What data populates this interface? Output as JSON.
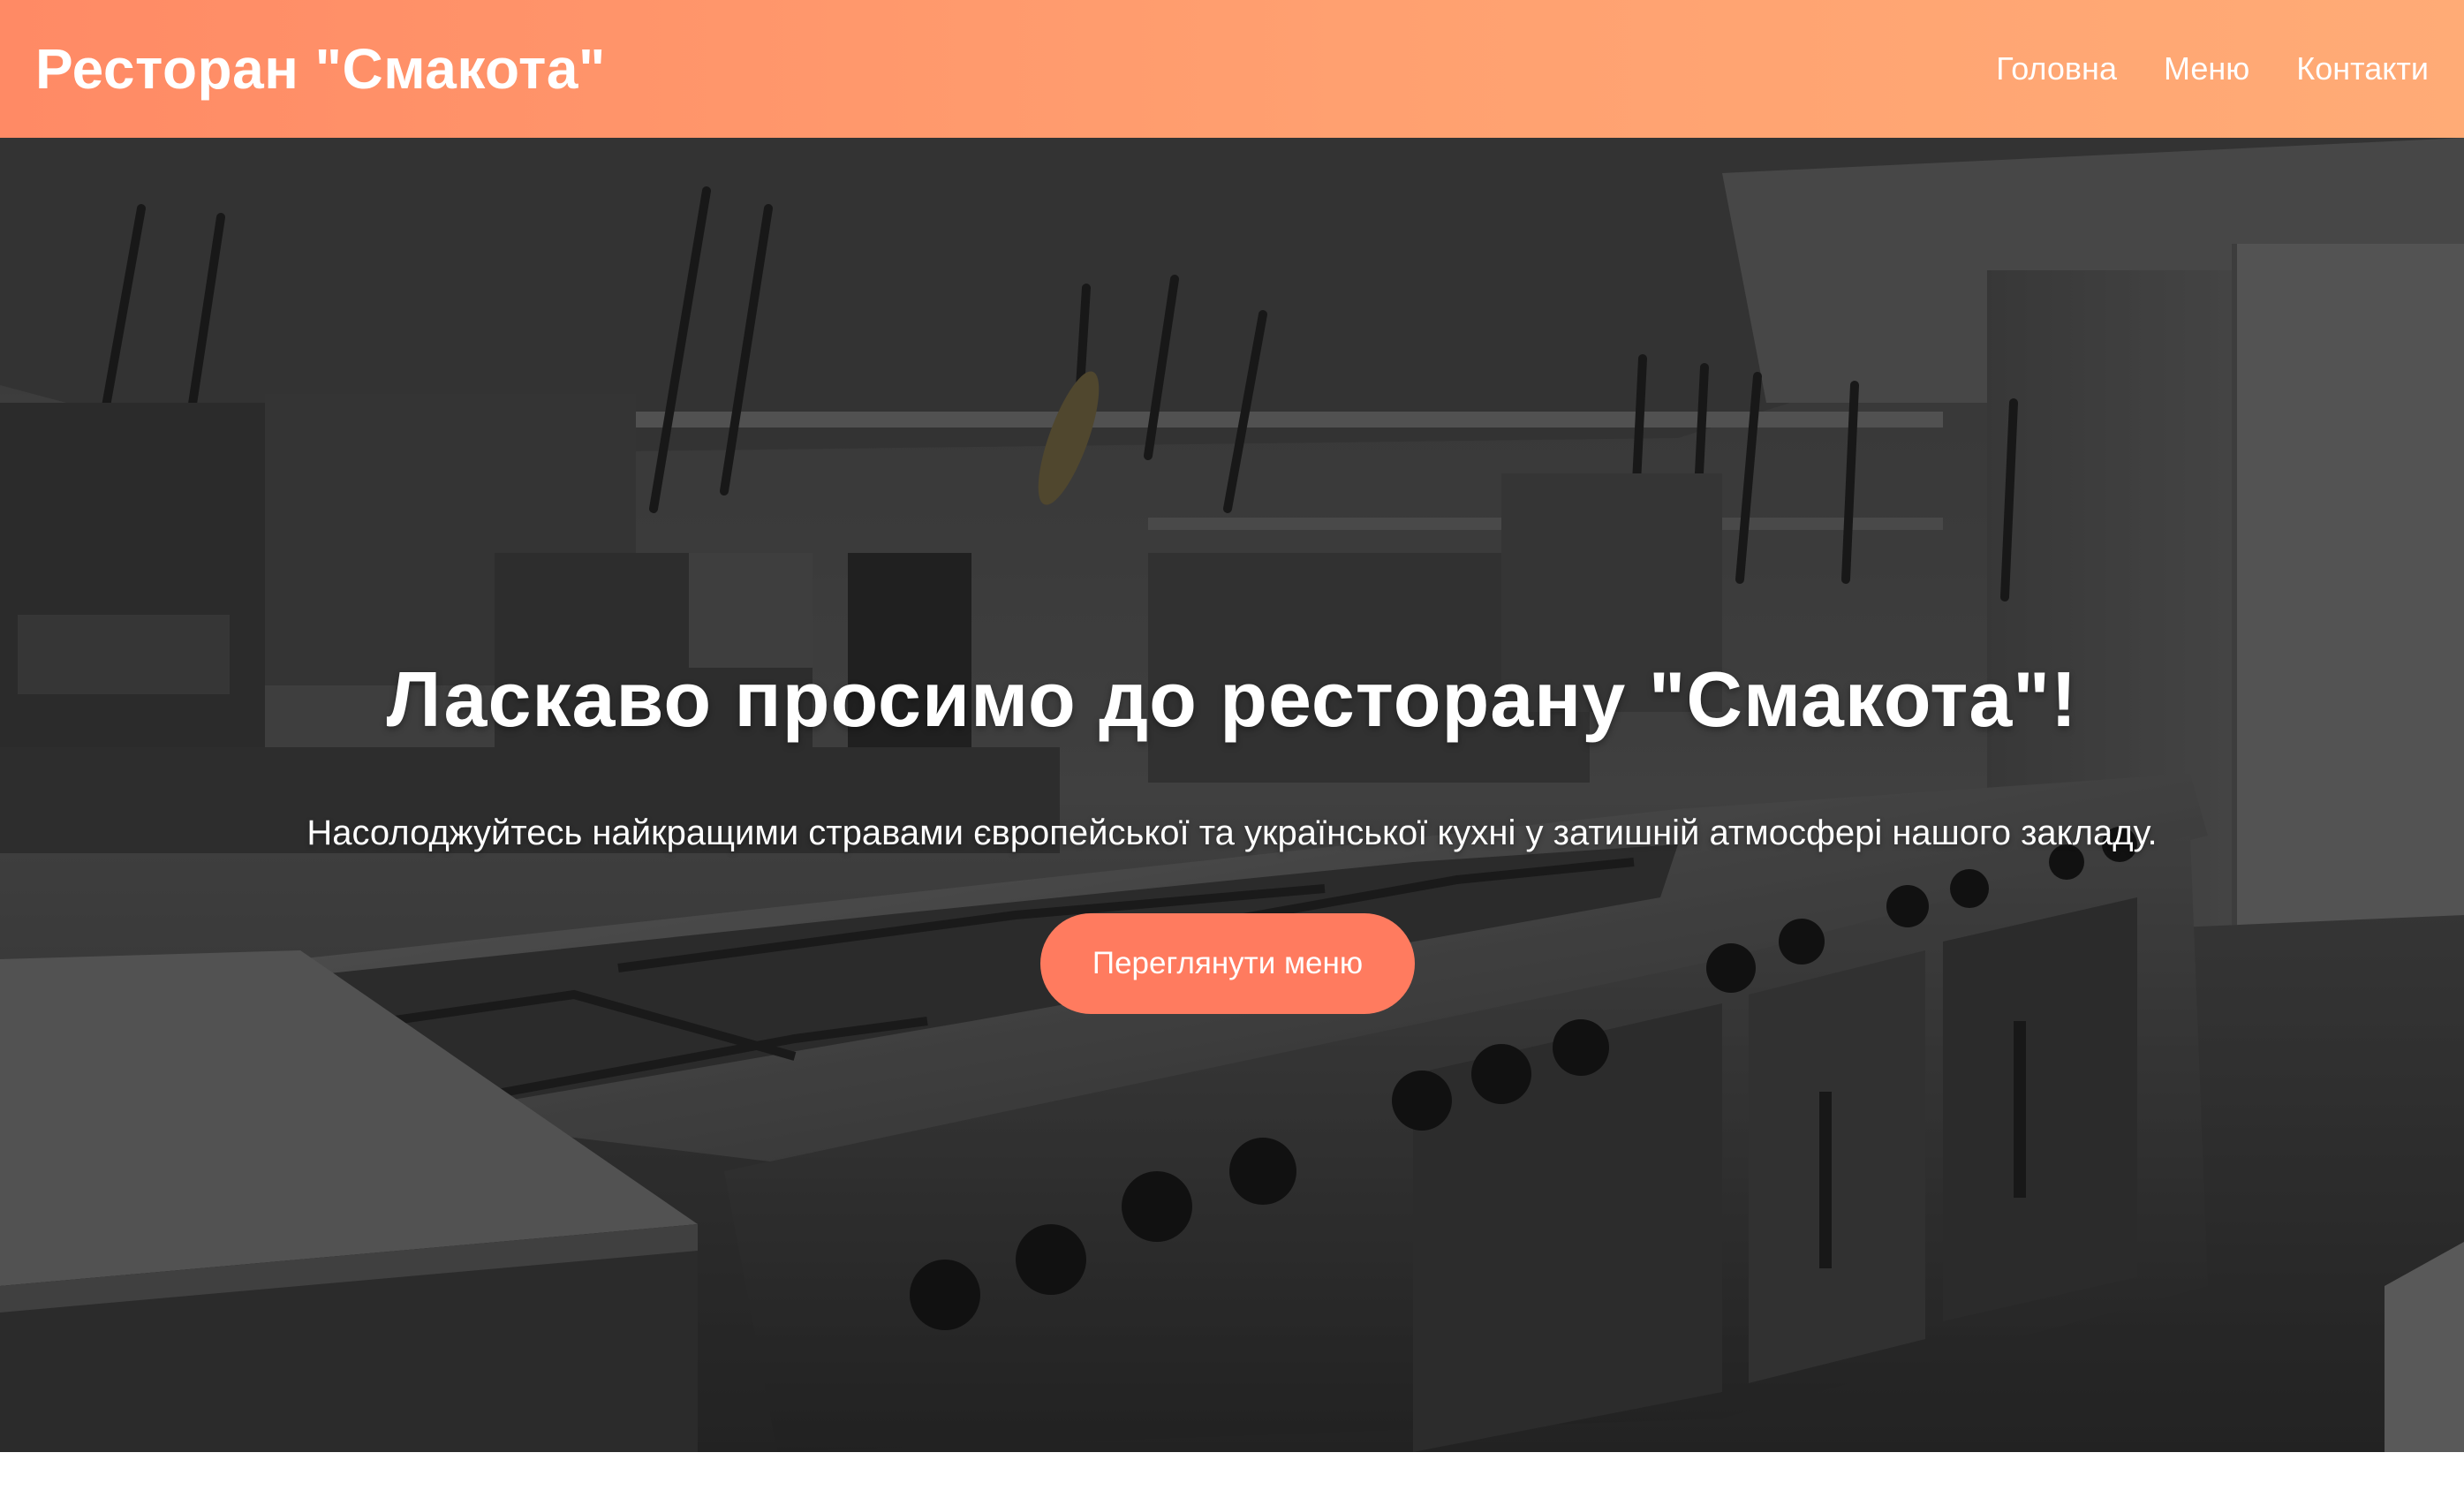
{
  "header": {
    "brand": "Ресторан \"Смакота\"",
    "nav": [
      {
        "label": "Головна"
      },
      {
        "label": "Меню"
      },
      {
        "label": "Контакти"
      }
    ]
  },
  "hero": {
    "title": "Ласкаво просимо до ресторану \"Смакота\"!",
    "subtitle": "Насолоджуйтесь найкращими стравами європейської та української кухні у затишній атмосфері нашого закладу.",
    "cta_label": "Переглянути меню",
    "background": "kitchen-photo"
  },
  "colors": {
    "header_gradient_start": "#ff8a65",
    "header_gradient_end": "#ffab76",
    "button": "#ff7b5f",
    "text_on_dark": "#ffffff"
  }
}
